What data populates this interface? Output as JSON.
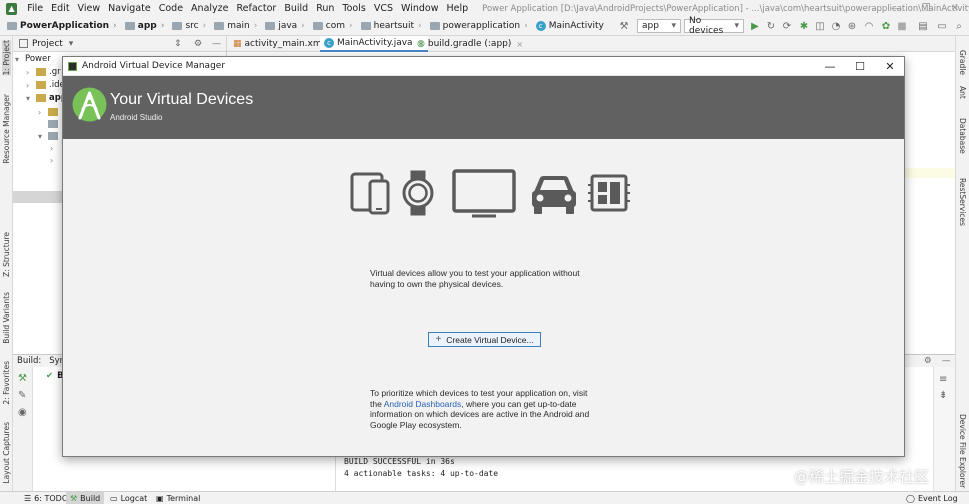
{
  "menubar": {
    "items": [
      "File",
      "Edit",
      "View",
      "Navigate",
      "Code",
      "Analyze",
      "Refactor",
      "Build",
      "Run",
      "Tools",
      "VCS",
      "Window",
      "Help"
    ],
    "window_title": "Power Application [D:\\Java\\AndroidProjects\\PowerApplication] - ...\\java\\com\\heartsuit\\powerapplication\\MainActivity.java [app]"
  },
  "navbar": {
    "crumbs": [
      "PowerApplication",
      "app",
      "src",
      "main",
      "java",
      "com",
      "heartsuit",
      "powerapplication",
      "MainActivity"
    ],
    "run_config": "app",
    "device": "No devices"
  },
  "left_stripe": {
    "tabs": [
      "1: Project",
      "Resource Manager",
      "Z: Structure",
      "Build Variants",
      "2: Favorites",
      "Layout Captures"
    ]
  },
  "right_stripe": {
    "tabs": [
      "Gradle",
      "Ant",
      "Database",
      "RestServices",
      "Device File Explorer"
    ]
  },
  "project_panel": {
    "title": "Project",
    "tree": [
      ".gr",
      ".ide",
      "app",
      "",
      "",
      "",
      ""
    ],
    "root": "Power"
  },
  "editor": {
    "tabs": [
      "activity_main.xml",
      "MainActivity.java",
      "build.gradle (:app)"
    ]
  },
  "build_panel": {
    "title": "Build:",
    "sync_label": "Syn",
    "tree_item": "B",
    "output": [
      "BUILD SUCCESSFUL in 36s",
      "4 actionable tasks: 4 up-to-date"
    ]
  },
  "statusbar": {
    "items": [
      "6: TODO",
      "Build",
      "Logcat",
      "Terminal"
    ],
    "event_log": "Event Log",
    "watermark": "@稀土掘金技术社区"
  },
  "avd_dialog": {
    "window_title": "Android Virtual Device Manager",
    "title": "Your Virtual Devices",
    "subtitle": "Android Studio",
    "device_icons": [
      "phone-tablet-icon",
      "watch-icon",
      "tv-icon",
      "car-icon",
      "things-icon"
    ],
    "description_line1": "Virtual devices allow you to test your application without",
    "description_line2": "having to own the physical devices.",
    "create_button": "Create Virtual Device...",
    "footer_part1": "To prioritize which devices to test your application on, visit the ",
    "footer_link": "Android Dashboards",
    "footer_part2": ", where you can get up-to-date information on which devices are active in the Android and Google Play ecosystem.",
    "colors": {
      "header_bg": "#616161",
      "logo_green": "#78c257",
      "link": "#2a64b4",
      "button_border": "#3d7ebf"
    }
  }
}
